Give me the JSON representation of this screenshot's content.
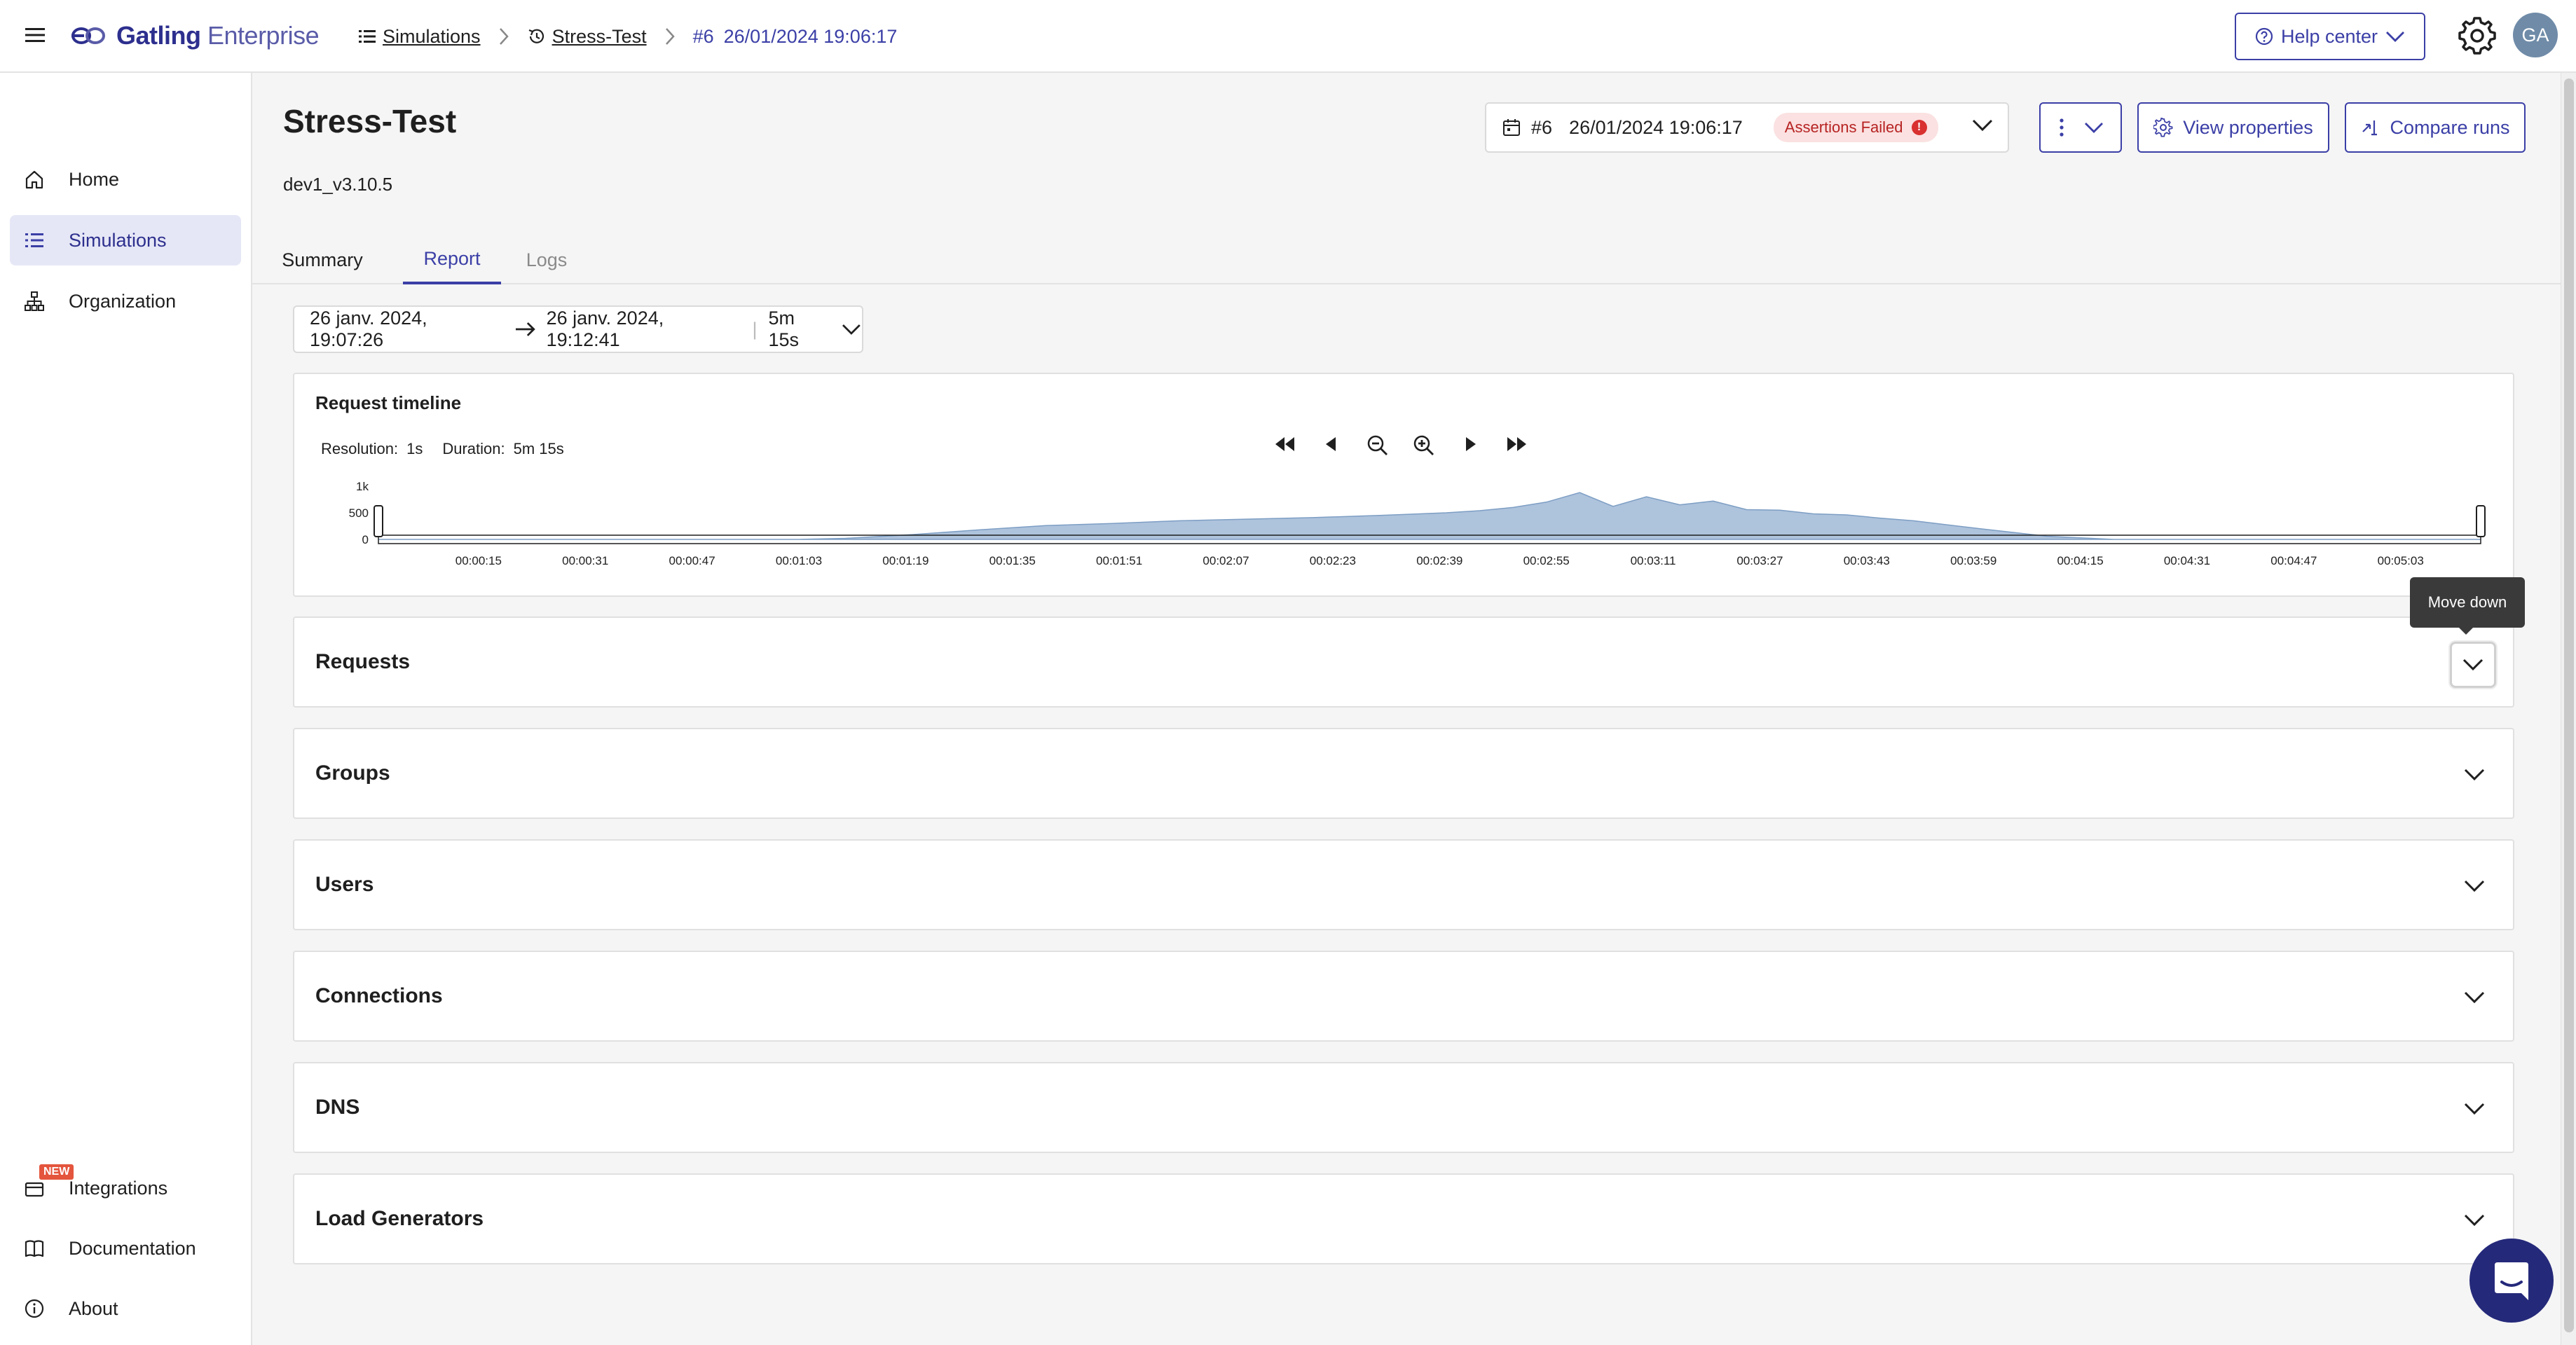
{
  "app": {
    "logo_brand": "Gatling",
    "logo_suffix": "Enterprise"
  },
  "breadcrumb": {
    "simulations": "Simulations",
    "simulation": "Stress-Test",
    "run_number": "#6",
    "run_datetime": "26/01/2024 19:06:17"
  },
  "header": {
    "help_center": "Help center",
    "avatar_initials": "GA"
  },
  "sidebar": {
    "items": [
      {
        "label": "Home"
      },
      {
        "label": "Simulations"
      },
      {
        "label": "Organization"
      }
    ],
    "bottom_items": [
      {
        "label": "Integrations",
        "badge": "NEW"
      },
      {
        "label": "Documentation"
      },
      {
        "label": "About"
      }
    ]
  },
  "page": {
    "title": "Stress-Test",
    "subtitle": "dev1_v3.10.5",
    "run_selector": {
      "run_number": "#6",
      "datetime": "26/01/2024 19:06:17",
      "status": "Assertions Failed",
      "status_icon": "!"
    },
    "view_properties": "View properties",
    "compare_runs": "Compare runs",
    "tabs": [
      {
        "label": "Summary"
      },
      {
        "label": "Report"
      },
      {
        "label": "Logs"
      }
    ],
    "range": {
      "from": "26 janv. 2024, 19:07:26",
      "to": "26 janv. 2024, 19:12:41",
      "duration": "5m 15s"
    }
  },
  "timeline": {
    "title": "Request timeline",
    "resolution_label": "Resolution:",
    "resolution_value": "1s",
    "duration_label": "Duration:",
    "duration_value": "5m 15s"
  },
  "chart_data": {
    "type": "area",
    "y_ticks": [
      "1k",
      "500",
      "0"
    ],
    "x_ticks": [
      "00:00:15",
      "00:00:31",
      "00:00:47",
      "00:01:03",
      "00:01:19",
      "00:01:35",
      "00:01:51",
      "00:02:07",
      "00:02:23",
      "00:02:39",
      "00:02:55",
      "00:03:11",
      "00:03:27",
      "00:03:43",
      "00:03:59",
      "00:04:15",
      "00:04:31",
      "00:04:47",
      "00:05:03"
    ],
    "ylim": [
      0,
      1000
    ],
    "xlim_seconds": [
      0,
      315
    ],
    "series": [
      {
        "x": [
          0,
          15,
          31,
          47,
          63,
          70,
          80,
          90,
          100,
          110,
          120,
          130,
          140,
          150,
          160,
          165,
          170,
          175,
          180,
          185,
          190,
          195,
          200,
          205,
          210,
          215,
          220,
          225,
          230,
          240,
          250,
          260,
          270,
          280,
          290,
          300,
          315
        ],
        "values": [
          0,
          0,
          0,
          0,
          0,
          20,
          90,
          180,
          260,
          300,
          350,
          380,
          410,
          450,
          500,
          540,
          600,
          700,
          880,
          620,
          800,
          650,
          720,
          560,
          550,
          480,
          460,
          400,
          350,
          200,
          60,
          0,
          0,
          0,
          0,
          0,
          0
        ]
      }
    ],
    "colors": {
      "fill": "#aec3dc",
      "stroke": "#7d9ec4"
    }
  },
  "sections": [
    {
      "title": "Requests"
    },
    {
      "title": "Groups"
    },
    {
      "title": "Users"
    },
    {
      "title": "Connections"
    },
    {
      "title": "DNS"
    },
    {
      "title": "Load Generators"
    }
  ],
  "tooltip": {
    "text": "Move down"
  },
  "colors": {
    "accent": "#3b3fa6",
    "danger_badge_bg": "#fbe1e1",
    "danger_text": "#b72323"
  }
}
